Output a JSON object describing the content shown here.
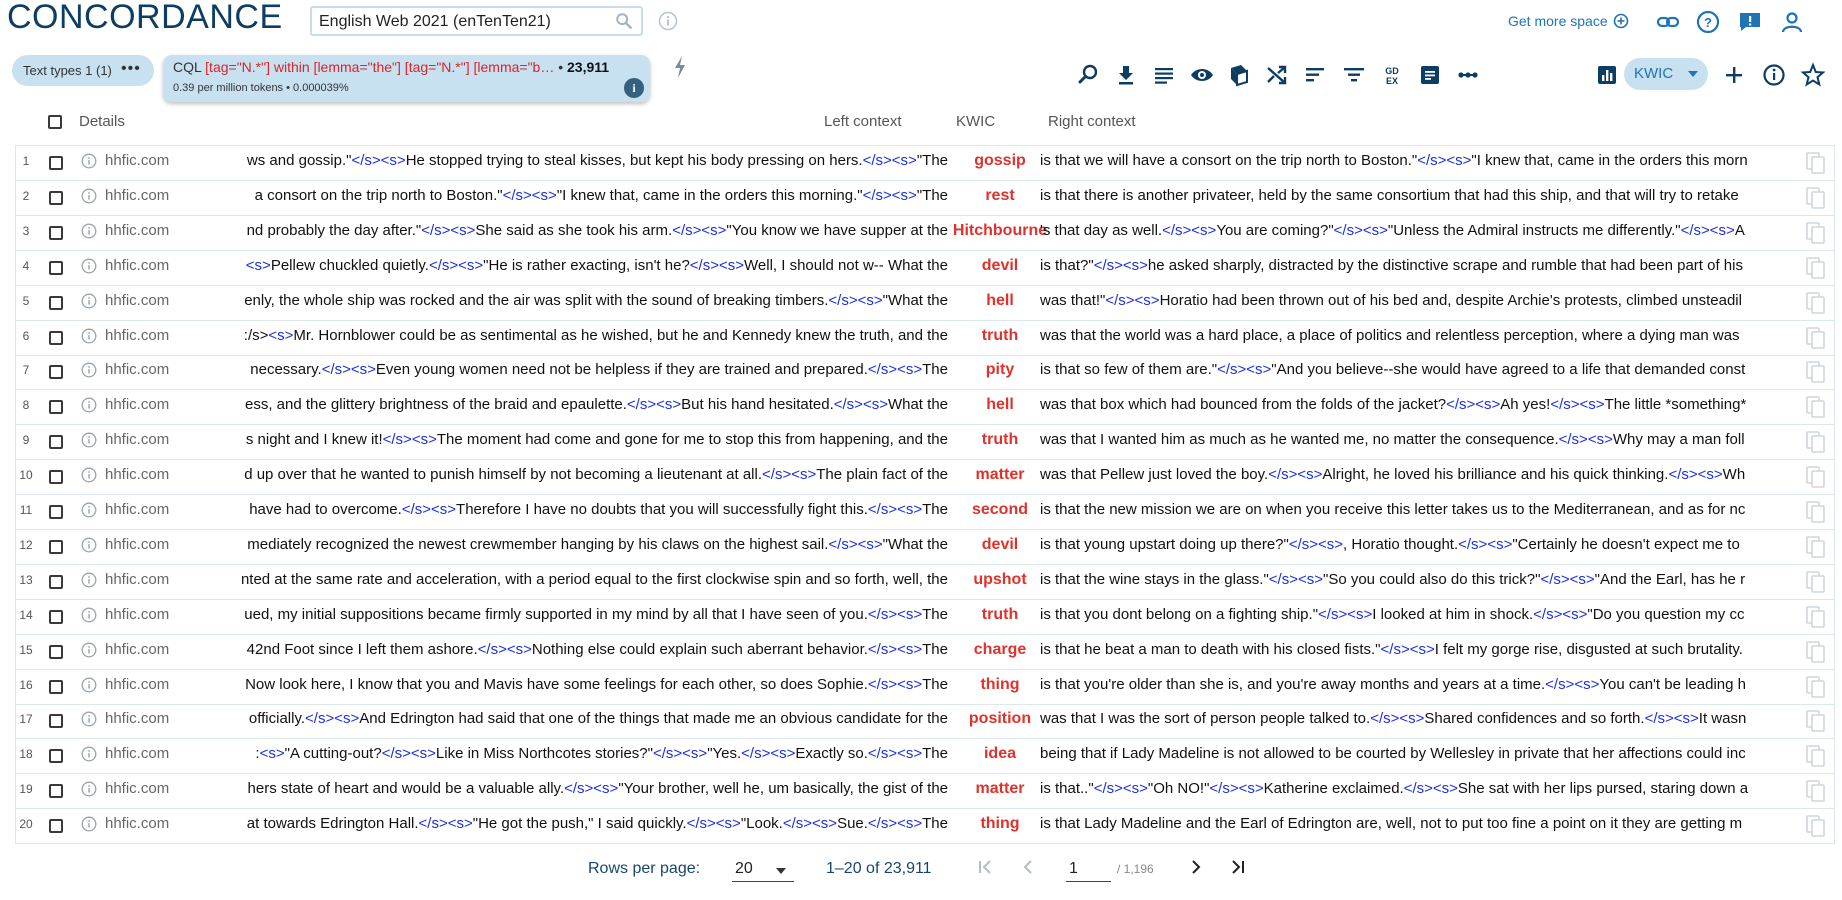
{
  "app": {
    "title": "CONCORDANCE",
    "corpus": "English Web 2021 (enTenTen21)",
    "get_more_space": "Get more space"
  },
  "filters": {
    "text_types_label": "Text types",
    "text_types_count": "1 (1)",
    "cql_prefix": "CQL",
    "cql_query": "[tag=\"N.*\"] within [lemma=\"the\"] [tag=\"N.*\"] [lemma=\"b…",
    "cql_count": "23,911",
    "cql_stats": "0.39 per million tokens • 0.000039%"
  },
  "toolbar": {
    "view_mode": "KWIC",
    "icons": [
      "search-zoom-icon",
      "download-icon",
      "lines-icon",
      "eye-icon",
      "dictionary-icon",
      "shuffle-icon",
      "sort-icon",
      "filter-icon",
      "gdex-icon",
      "note-icon",
      "more-icon",
      "frequency-icon"
    ]
  },
  "table": {
    "headers": {
      "details": "Details",
      "left": "Left context",
      "kwic": "KWIC",
      "right": "Right context"
    },
    "rows": [
      {
        "n": "1",
        "src": "hhfic.com",
        "left": "ws and gossip.\"</s><s>He stopped trying to steal kisses, but kept his body pressing on hers.</s><s>\"The",
        "kwic": "gossip",
        "right": "is that we will have a consort on the trip north to Boston.\"</s><s>\"I knew that, came in the orders this morn"
      },
      {
        "n": "2",
        "src": "hhfic.com",
        "left": "a consort on the trip north to Boston.\"</s><s>\"I knew that, came in the orders this morning.\"</s><s>\"The",
        "kwic": "rest",
        "right": "is that there is another privateer, held by the same consortium that had this ship, and that will try to retake"
      },
      {
        "n": "3",
        "src": "hhfic.com",
        "left": "nd probably the day after.\"</s><s>She said as she took his arm.</s><s>\"You know we have supper at the",
        "kwic": "Hitchbourne",
        "right": "'s that day as well.</s><s>You are coming?\"</s><s>\"Unless the Admiral instructs me differently.\"</s><s>A"
      },
      {
        "n": "4",
        "src": "hhfic.com",
        "left": "<s>Pellew chuckled quietly.</s><s>\"He is rather exacting, isn't he?</s><s>Well, I should not w-- What the",
        "kwic": "devil",
        "right": "is that?\"</s><s>he asked sharply, distracted by the distinctive scrape and rumble that had been part of his"
      },
      {
        "n": "5",
        "src": "hhfic.com",
        "left": "enly, the whole ship was rocked and the air was split with the sound of breaking timbers.</s><s>\"What the",
        "kwic": "hell",
        "right": "was that!\"</s><s>Horatio had been thrown out of his bed and, despite Archie's protests, climbed unsteadil"
      },
      {
        "n": "6",
        "src": "hhfic.com",
        "left": ":/s><s>Mr. Hornblower could be as sentimental as he wished, but he and Kennedy knew the truth, and the",
        "kwic": "truth",
        "right": "was that the world was a hard place, a place of politics and relentless perception, where a dying man was"
      },
      {
        "n": "7",
        "src": "hhfic.com",
        "left": "necessary.</s><s>Even young women need not be helpless if they are trained and prepared.</s><s>The",
        "kwic": "pity",
        "right": "is that so few of them are.\"</s><s>\"And you believe--she would have agreed to a life that demanded const"
      },
      {
        "n": "8",
        "src": "hhfic.com",
        "left": "ess, and the glittery brightness of the braid and epaulette.</s><s>But his hand hesitated.</s><s>What the",
        "kwic": "hell",
        "right": "was that box which had bounced from the folds of the jacket?</s><s>Ah yes!</s><s>The little *something*"
      },
      {
        "n": "9",
        "src": "hhfic.com",
        "left": "s night and I knew it!</s><s>The moment had come and gone for me to stop this from happening, and the",
        "kwic": "truth",
        "right": "was that I wanted him as much as he wanted me, no matter the consequence.</s><s>Why may a man foll"
      },
      {
        "n": "10",
        "src": "hhfic.com",
        "left": "d up over that he wanted to punish himself by not becoming a lieutenant at all.</s><s>The plain fact of the",
        "kwic": "matter",
        "right": "was that Pellew just loved the boy.</s><s>Alright, he loved his brilliance and his quick thinking.</s><s>Wh"
      },
      {
        "n": "11",
        "src": "hhfic.com",
        "left": "have had to overcome.</s><s>Therefore I have no doubts that you will successfully fight this.</s><s>The",
        "kwic": "second",
        "right": "is that the new mission we are on when you receive this letter takes us to the Mediterranean, and as for nc"
      },
      {
        "n": "12",
        "src": "hhfic.com",
        "left": "mediately recognized the newest crewmember hanging by his claws on the highest sail.</s><s>\"What the",
        "kwic": "devil",
        "right": "is that young upstart doing up there?\"</s><s>, Horatio thought.</s><s>\"Certainly he doesn't expect me to"
      },
      {
        "n": "13",
        "src": "hhfic.com",
        "left": "nted at the same rate and acceleration, with a period equal to the first clockwise spin and so forth, well, the",
        "kwic": "upshot",
        "right": "is that the wine stays in the glass.\"</s><s>\"So you could also do this trick?\"</s><s>\"And the Earl, has he r"
      },
      {
        "n": "14",
        "src": "hhfic.com",
        "left": "ued, my initial suppositions became firmly supported in my mind by all that I have seen of you.</s><s>The",
        "kwic": "truth",
        "right": "is that you dont belong on a fighting ship.\"</s><s>I looked at him in shock.</s><s>\"Do you question my cc"
      },
      {
        "n": "15",
        "src": "hhfic.com",
        "left": "42nd Foot since I left them ashore.</s><s>Nothing else could explain such aberrant behavior.</s><s>The",
        "kwic": "charge",
        "right": "is that he beat a man to death with his closed fists.\"</s><s>I felt my gorge rise, disgusted at such brutality."
      },
      {
        "n": "16",
        "src": "hhfic.com",
        "left": "Now look here, I know that you and Mavis have some feelings for each other, so does Sophie.</s><s>The",
        "kwic": "thing",
        "right": "is that you're older than she is, and you're away months and years at a time.</s><s>You can't be leading h"
      },
      {
        "n": "17",
        "src": "hhfic.com",
        "left": "officially.</s><s>And Edrington had said that one of the things that made me an obvious candidate for the",
        "kwic": "position",
        "right": "was that I was the sort of person people talked to.</s><s>Shared confidences and so forth.</s><s>It wasn"
      },
      {
        "n": "18",
        "src": "hhfic.com",
        "left": ":<s>\"A cutting-out?</s><s>Like in Miss Northcotes stories?\"</s><s>\"Yes.</s><s>Exactly so.</s><s>The",
        "kwic": "idea",
        "right": "being that if Lady Madeline is not allowed to be courted by Wellesley in private that her affections could inc"
      },
      {
        "n": "19",
        "src": "hhfic.com",
        "left": "hers state of heart and would be a valuable ally.</s><s>\"Your brother, well he, um basically, the gist of the",
        "kwic": "matter",
        "right": "is that..\"</s><s>\"Oh NO!\"</s><s>Katherine exclaimed.</s><s>She sat with her lips pursed, staring down a"
      },
      {
        "n": "20",
        "src": "hhfic.com",
        "left": "at towards Edrington Hall.</s><s>\"He got the push,\" I said quickly.</s><s>\"Look.</s><s>Sue.</s><s>The",
        "kwic": "thing",
        "right": "is that Lady Madeline and the Earl of Edrington are, well, not to put too fine a point on it they are getting m"
      }
    ]
  },
  "pagination": {
    "rows_per_page_label": "Rows per page:",
    "rows_per_page": "20",
    "range": "1–20 of 23,911",
    "page": "1",
    "total_pages": "/ 1,196"
  },
  "colors": {
    "brand": "#0d3d63",
    "accent": "#1f74b5",
    "kwic": "#e0322c",
    "tag": "#1d2fe0",
    "chip": "#c8e1f1"
  }
}
